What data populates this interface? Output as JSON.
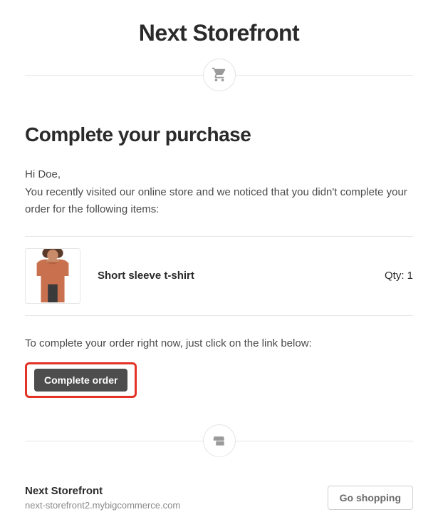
{
  "header": {
    "title": "Next Storefront"
  },
  "main": {
    "heading": "Complete your purchase",
    "greeting": "Hi Doe,",
    "intro": "You recently visited our online store and we noticed that you didn't complete your order for the following items:",
    "cta_text": "To complete your order right now, just click on the link below:",
    "button_label": "Complete order"
  },
  "item": {
    "name": "Short sleeve t-shirt",
    "qty_label": "Qty: 1"
  },
  "footer": {
    "shop_name": "Next Storefront",
    "shop_url": "next-storefront2.mybigcommerce.com",
    "go_shopping_label": "Go shopping"
  }
}
